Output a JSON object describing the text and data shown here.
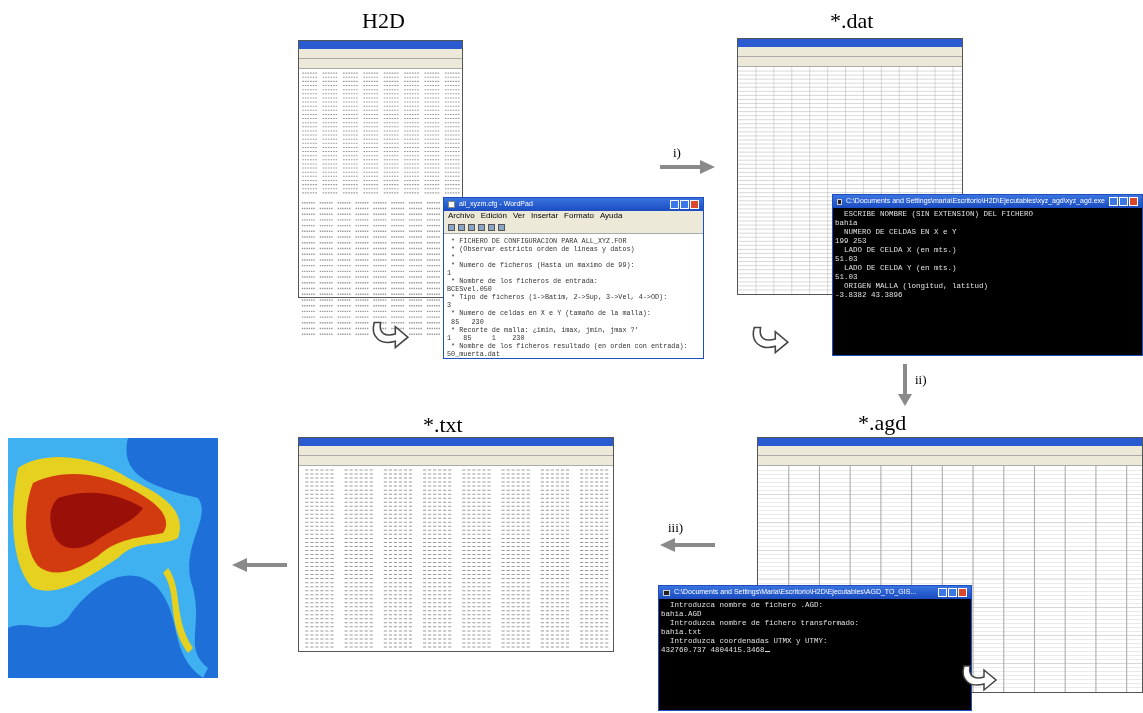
{
  "steps": [
    {
      "label": "H2D"
    },
    {
      "label": "*.dat"
    },
    {
      "label": "*.agd"
    },
    {
      "label": "*.txt"
    }
  ],
  "arrows": [
    {
      "label": "i)"
    },
    {
      "label": "ii)"
    },
    {
      "label": "iii)"
    }
  ],
  "wordpad": {
    "title": "all_xyzm.cfg - WordPad",
    "menu": [
      "Archivo",
      "Edición",
      "Ver",
      "Insertar",
      "Formato",
      "Ayuda"
    ],
    "lines": [
      " * FICHERO DE CONFIGURACION PARA ALL_XYZ.FOR",
      " * (Observar estricto orden de lineas y datos)",
      " *",
      " * Numero de ficheros (Hasta un maximo de 99):",
      "1",
      " * Nombre de los ficheros de entrada:",
      "BCESvel.050",
      " * Tipo de ficheros (1->Batim, 2->Sup, 3->Vel, 4->OD):",
      "3",
      " * Numero de celdas en X e Y (tamaño de la malla):",
      " 85   230",
      " * Recorte de malla: ¿imin, imax, jmin, jmax ?'",
      "1   85     1    230",
      " * Nombre de los ficheros resultado (en orden con entrada):",
      "50_muerta.dat"
    ]
  },
  "consoles": [
    {
      "title": "C:\\Documents and Settings\\maria\\Escritorio\\H2D\\Ejecutables\\xyz_agd\\xyz_agd.exe",
      "lines": [
        "  ESCRIBE NOMBRE (SIN EXTENSION) DEL FICHERO",
        "bahia",
        "  NUMERO DE CELDAS EN X e Y",
        "199 253",
        "  LADO DE CELDA X (en mts.)",
        "51.03",
        "  LADO DE CELDA Y (en mts.)",
        "51.03",
        "  ORIGEN MALLA (longitud, latitud)",
        "-3.8382 43.3896"
      ]
    },
    {
      "title": "C:\\Documents and Settings\\Maria\\Escritorio\\H2D\\Ejecutables\\AGD_TO_GIS...",
      "lines": [
        "  Introduzca nombre de fichero .AGD:",
        "bahia.AGD",
        "  Introduzca nombre de fichero transformado:",
        "bahia.txt",
        "  Introduzca coordenadas UTMX y UTMY:",
        "432760.737 4804415.3468"
      ]
    }
  ]
}
